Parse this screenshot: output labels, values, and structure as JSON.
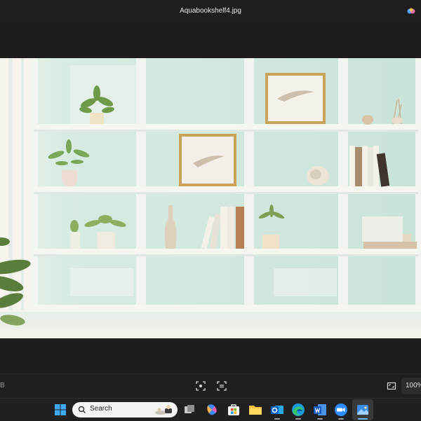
{
  "window": {
    "title": "Aquabookshelf4.jpg"
  },
  "photo": {
    "description_icon": "bookshelf-photo",
    "colors": {
      "wall": "#cfe6dc",
      "shelf": "#f4f3ee",
      "frame_gold": "#c9a35a"
    }
  },
  "bottom_bar": {
    "size_partial": "B",
    "zoom_partial": "100%"
  },
  "taskbar": {
    "search_label": "Search",
    "apps": [
      "start",
      "search",
      "task-view",
      "copilot",
      "store",
      "file-explorer",
      "outlook",
      "edge",
      "word",
      "zoom",
      "photos"
    ]
  }
}
